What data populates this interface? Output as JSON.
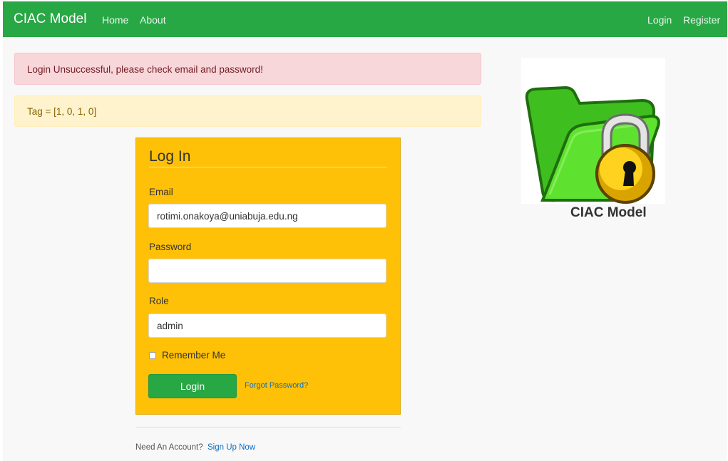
{
  "navbar": {
    "brand": "CIAC Model",
    "left_links": [
      "Home",
      "About"
    ],
    "right_links": [
      "Login",
      "Register"
    ],
    "color": "#28a745"
  },
  "alerts": {
    "danger": "Login Unsuccessful, please check email and password!",
    "warning": "Tag = [1, 0, 1, 0]"
  },
  "login_form": {
    "legend": "Log In",
    "email_label": "Email",
    "email_value": "rotimi.onakoya@uniabuja.edu.ng",
    "password_label": "Password",
    "password_value": "",
    "role_label": "Role",
    "role_value": "admin",
    "remember_label": "Remember Me",
    "remember_checked": false,
    "submit_label": "Login",
    "forgot_link": "Forgot Password?",
    "card_color": "#ffc107"
  },
  "footer": {
    "prompt": "Need An Account?",
    "signup_link": "Sign Up Now"
  },
  "logo": {
    "icon": "locked-folder-icon",
    "caption": "CIAC Model"
  }
}
